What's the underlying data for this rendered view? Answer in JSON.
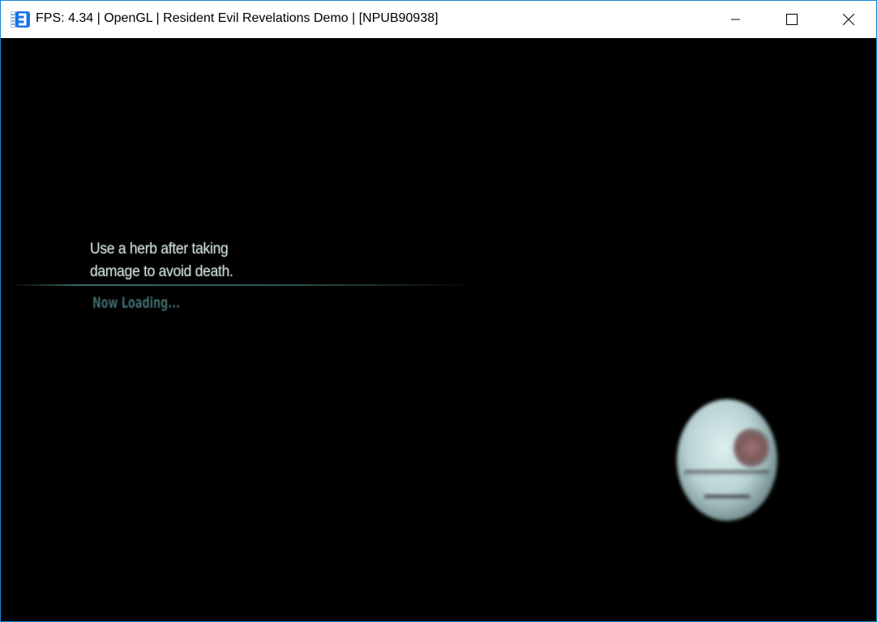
{
  "window": {
    "title": "FPS: 4.34 | OpenGL | Resident Evil Revelations Demo | [NPUB90938]",
    "accent_color": "#1883d7"
  },
  "game": {
    "tip_line1": "Use a herb after taking",
    "tip_line2": "damage to avoid death.",
    "loading_text": "Now Loading..."
  }
}
